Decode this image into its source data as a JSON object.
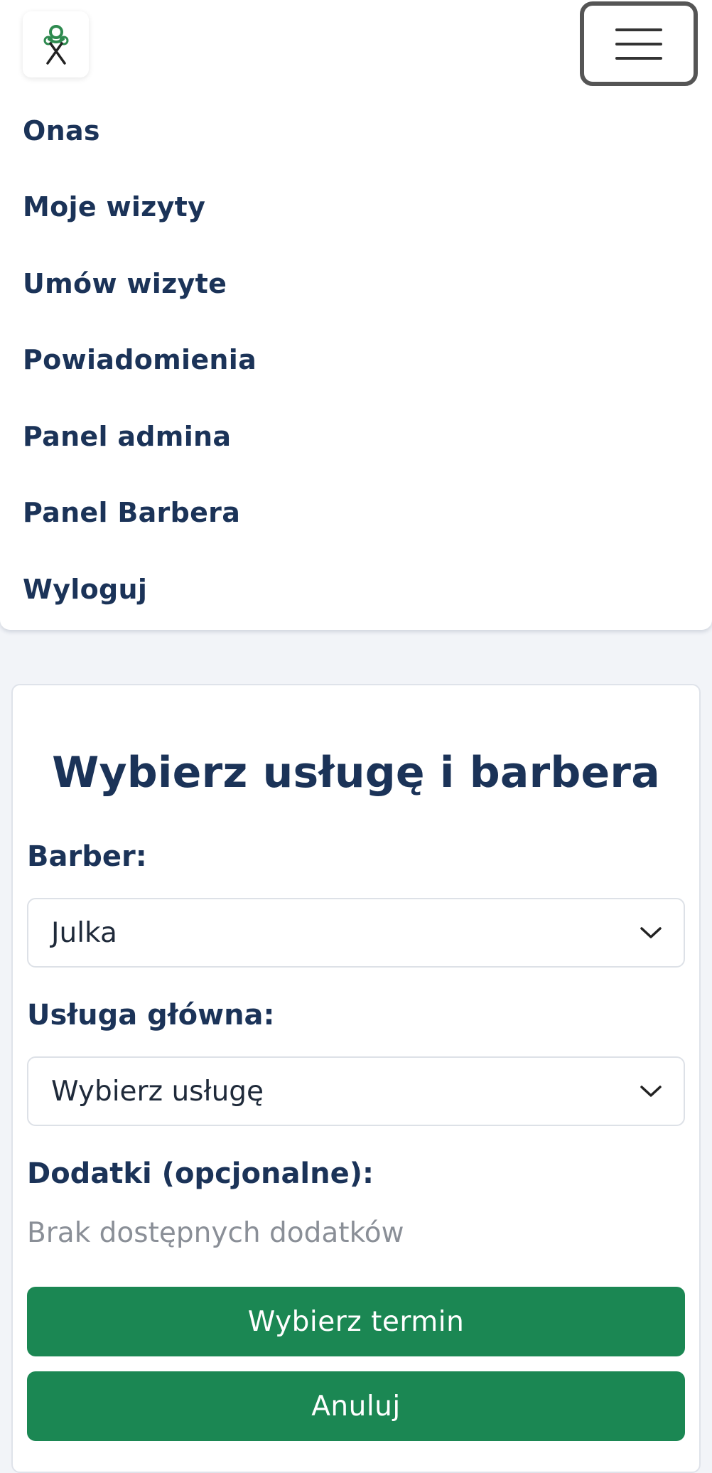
{
  "navbar": {
    "logo_icon": "barber-scissors-logo-icon",
    "toggler_icon": "hamburger-menu-icon",
    "items": [
      {
        "label": "Onas"
      },
      {
        "label": "Moje wizyty"
      },
      {
        "label": "Umów wizyte"
      },
      {
        "label": "Powiadomienia"
      },
      {
        "label": "Panel admina"
      },
      {
        "label": "Panel Barbera"
      },
      {
        "label": "Wyloguj"
      }
    ]
  },
  "form": {
    "title": "Wybierz usługę i barbera",
    "barber_label": "Barber:",
    "barber_value": "Julka",
    "service_label": "Usługa główna:",
    "service_value": "Wybierz usługę",
    "addons_label": "Dodatki (opcjonalne):",
    "addons_empty": "Brak dostępnych dodatków",
    "select_chevron_icon": "chevron-down-icon",
    "choose_date_button": "Wybierz termin",
    "cancel_button": "Anuluj"
  },
  "colors": {
    "primary_text": "#1b3358",
    "button_green": "#1b8753",
    "page_background": "#f2f4f8",
    "muted_text": "#8a8f97"
  }
}
